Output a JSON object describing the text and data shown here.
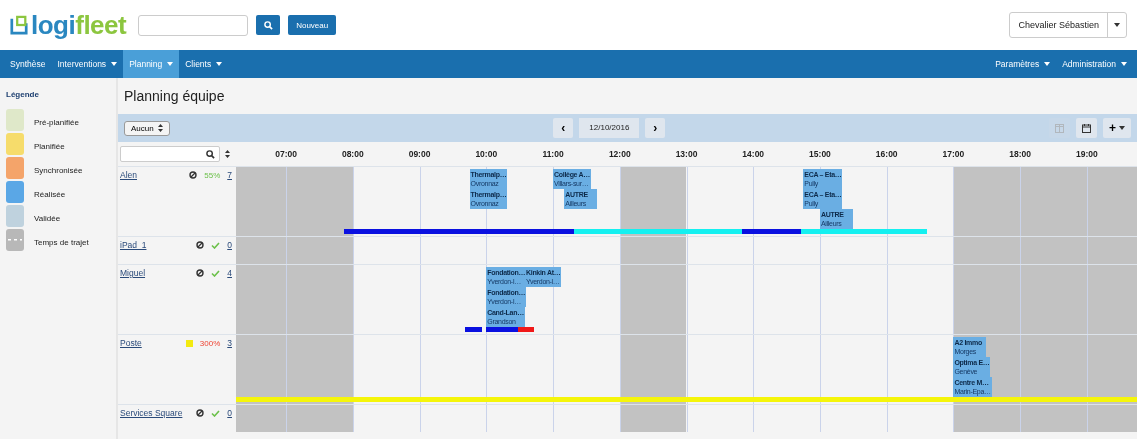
{
  "logo": [
    "logi",
    "fleet"
  ],
  "header": {
    "new_button": "Nouveau",
    "user": "Chevalier Sébastien"
  },
  "nav": {
    "left": [
      {
        "label": "Synthèse",
        "dropdown": false,
        "selected": false
      },
      {
        "label": "Interventions",
        "dropdown": true,
        "selected": false
      },
      {
        "label": "Planning",
        "dropdown": true,
        "selected": true
      },
      {
        "label": "Clients",
        "dropdown": true,
        "selected": false
      }
    ],
    "right": [
      {
        "label": "Paramètres",
        "dropdown": true
      },
      {
        "label": "Administration",
        "dropdown": true
      }
    ]
  },
  "legend": {
    "title": "Légende",
    "items": [
      {
        "label": "Pré-planifiée",
        "color": "#dfe8c9",
        "kind": "status"
      },
      {
        "label": "Planifiée",
        "color": "#f6dc6b",
        "kind": "status"
      },
      {
        "label": "Synchronisée",
        "color": "#f4a46a",
        "kind": "status"
      },
      {
        "label": "Réalisée",
        "color": "#5aa7e6",
        "kind": "status"
      },
      {
        "label": "Validée",
        "color": "#bfd2de",
        "kind": "status"
      },
      {
        "label": "Temps de trajet",
        "color": "#b8b8b8",
        "kind": "travel"
      }
    ]
  },
  "page_title": "Planning équipe",
  "toolbar": {
    "filter": "Aucun",
    "date": "12/10/2016",
    "prev": "‹",
    "next": "›",
    "add": "+"
  },
  "hours": [
    "07:00",
    "08:00",
    "09:00",
    "10:00",
    "11:00",
    "12:00",
    "13:00",
    "14:00",
    "15:00",
    "16:00",
    "17:00",
    "18:00",
    "19:00"
  ],
  "rows": [
    {
      "name": "Alen",
      "kind": "ban",
      "load": "55%",
      "overloaded": false,
      "check": false,
      "count": "7",
      "events": [
        {
          "title": "Thermalp…",
          "place": "Ovronnaz"
        },
        {
          "title": "Thermalp…",
          "place": "Ovronnaz"
        },
        {
          "title": "Collège A…",
          "place": "Villars-sur…"
        },
        {
          "title": "AUTRE",
          "place": "Ailleurs"
        },
        {
          "title": "ECA – Eta…",
          "place": "Pully"
        },
        {
          "title": "ECA – Eta…",
          "place": "Pully"
        },
        {
          "title": "AUTRE",
          "place": "Ailleurs"
        }
      ],
      "bars": [
        {
          "color": "#0a10e0"
        },
        {
          "color": "#14f0f0"
        },
        {
          "color": "#0a10e0"
        },
        {
          "color": "#14f0f0"
        }
      ]
    },
    {
      "name": "iPad_1",
      "kind": "ban",
      "check": true,
      "count": "0",
      "events": [],
      "bars": []
    },
    {
      "name": "Miguel",
      "kind": "ban",
      "check": true,
      "count": "4",
      "events": [
        {
          "title": "Fondation…",
          "place": "Yverdon-l…"
        },
        {
          "title": "Kinkin At…",
          "place": "Yverdon-l…"
        },
        {
          "title": "Fondation…",
          "place": "Yverdon-l…"
        },
        {
          "title": "Cand-Lan…",
          "place": "Grandson"
        }
      ],
      "bars": [
        {
          "color": "#0a10e0"
        },
        {
          "color": "#0a10e0"
        },
        {
          "color": "#f01818"
        }
      ]
    },
    {
      "name": "Poste",
      "kind": "square",
      "load": "300%",
      "overloaded": true,
      "check": false,
      "count": "3",
      "events": [
        {
          "title": "A2 Immo",
          "place": "Morges"
        },
        {
          "title": "Optima E…",
          "place": "Genève"
        },
        {
          "title": "Centre M…",
          "place": "Marin-Epa…"
        }
      ],
      "bars": [
        {
          "color": "#f5f50a"
        }
      ]
    },
    {
      "name": "Services Square",
      "kind": "ban",
      "check": true,
      "count": "0",
      "events": [],
      "bars": []
    }
  ]
}
